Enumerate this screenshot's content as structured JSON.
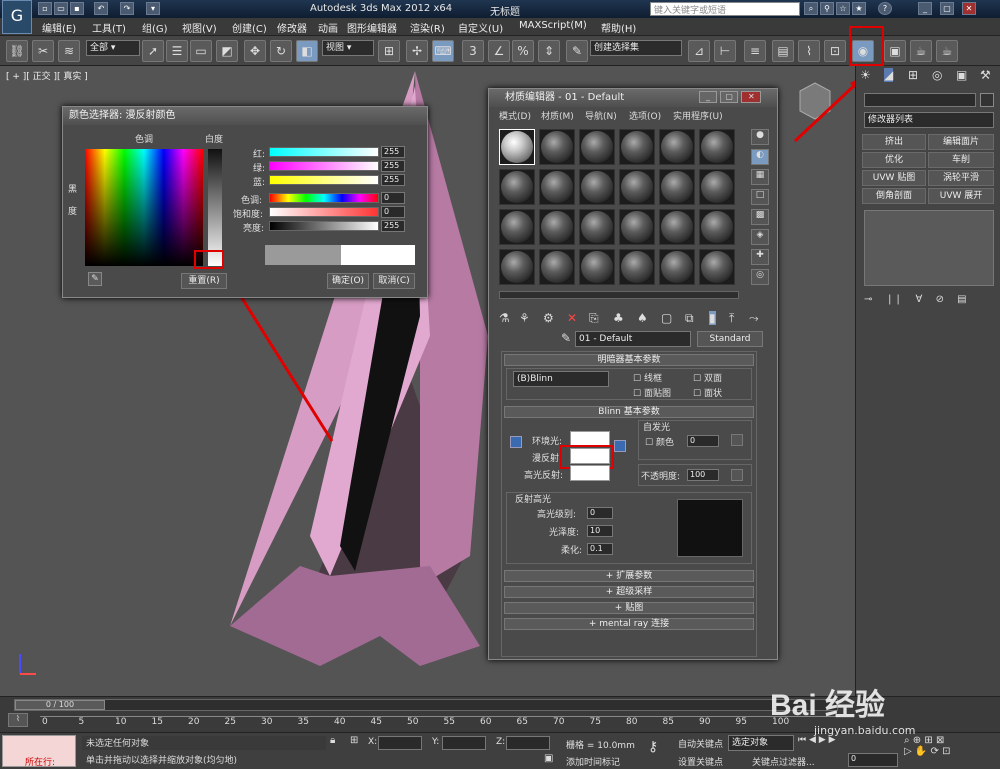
{
  "titlebar": {
    "app_title": "Autodesk 3ds Max  2012 x64",
    "doc_title": "无标题",
    "search_placeholder": "键入关键字或短语"
  },
  "menu": [
    "编辑(E)",
    "工具(T)",
    "组(G)",
    "视图(V)",
    "创建(C)",
    "修改器",
    "动画",
    "图形编辑器",
    "渲染(R)",
    "自定义(U)",
    "MAXScript(M)",
    "帮助(H)"
  ],
  "toolbar": {
    "selection_filter": "全部",
    "ref_coord": "视图",
    "named_selection": "创建选择集"
  },
  "viewport": {
    "label": "[ + ][ 正交 ][ 真实 ]"
  },
  "cmd_panel": {
    "modifier_list": "修改器列表",
    "buttons": [
      "挤出",
      "编辑面片",
      "优化",
      "车削",
      "UVW 贴图",
      "涡轮平滑",
      "倒角剖面",
      "UVW 展开"
    ]
  },
  "color_picker": {
    "title": "颜色选择器: 漫反射颜色",
    "hue_label": "色调",
    "white_label": "白度",
    "black_label": "黑",
    "degree_label": "度",
    "red": "红:",
    "green": "绿:",
    "blue": "蓝:",
    "hue": "色调:",
    "saturation": "饱和度:",
    "value": "亮度:",
    "red_val": "255",
    "green_val": "255",
    "blue_val": "255",
    "hue_val": "0",
    "sat_val": "0",
    "lum_val": "255",
    "reset": "重置(R)",
    "ok": "确定(O)",
    "cancel": "取消(C)"
  },
  "mat_editor": {
    "title": "材质编辑器 - 01 - Default",
    "menu": [
      "模式(D)",
      "材质(M)",
      "导航(N)",
      "选项(O)",
      "实用程序(U)"
    ],
    "mat_name": "01 - Default",
    "mat_type": "Standard",
    "shader_rollout": "明暗器基本参数",
    "shader": "(B)Blinn",
    "wire": "线框",
    "two_sided": "双面",
    "face_map": "面贴图",
    "faceted": "面状",
    "blinn_rollout": "Blinn 基本参数",
    "self_illum": "自发光",
    "color": "颜色",
    "color_val": "0",
    "ambient": "环境光:",
    "diffuse": "漫反射:",
    "specular": "高光反射:",
    "opacity": "不透明度:",
    "opacity_val": "100",
    "spec_group": "反射高光",
    "spec_level": "高光级别:",
    "spec_level_val": "0",
    "gloss": "光泽度:",
    "gloss_val": "10",
    "soften": "柔化:",
    "soften_val": "0.1",
    "rollouts": [
      "扩展参数",
      "超级采样",
      "贴图",
      "mental ray 连接"
    ]
  },
  "timeline": {
    "frame": "0 / 100",
    "ticks": [
      "0",
      "5",
      "10",
      "15",
      "20",
      "25",
      "30",
      "35",
      "40",
      "45",
      "50",
      "55",
      "60",
      "65",
      "70",
      "75",
      "80",
      "85",
      "90",
      "95",
      "100"
    ]
  },
  "status": {
    "script_label": "所在行:",
    "selection": "未选定任何对象",
    "prompt": "单击并拖动以选择并缩放对象(均匀地)",
    "x": "X:",
    "y": "Y:",
    "z": "Z:",
    "grid": "栅格 = 10.0mm",
    "add_time_tag": "添加时间标记",
    "auto_key": "自动关键点",
    "set_key": "设置关键点",
    "key_mode": "选定对象",
    "key_filters": "关键点过滤器...",
    "frame_val": "0"
  },
  "watermark": {
    "text": "Bai 经验",
    "sub": "jingyan.baidu.com"
  }
}
